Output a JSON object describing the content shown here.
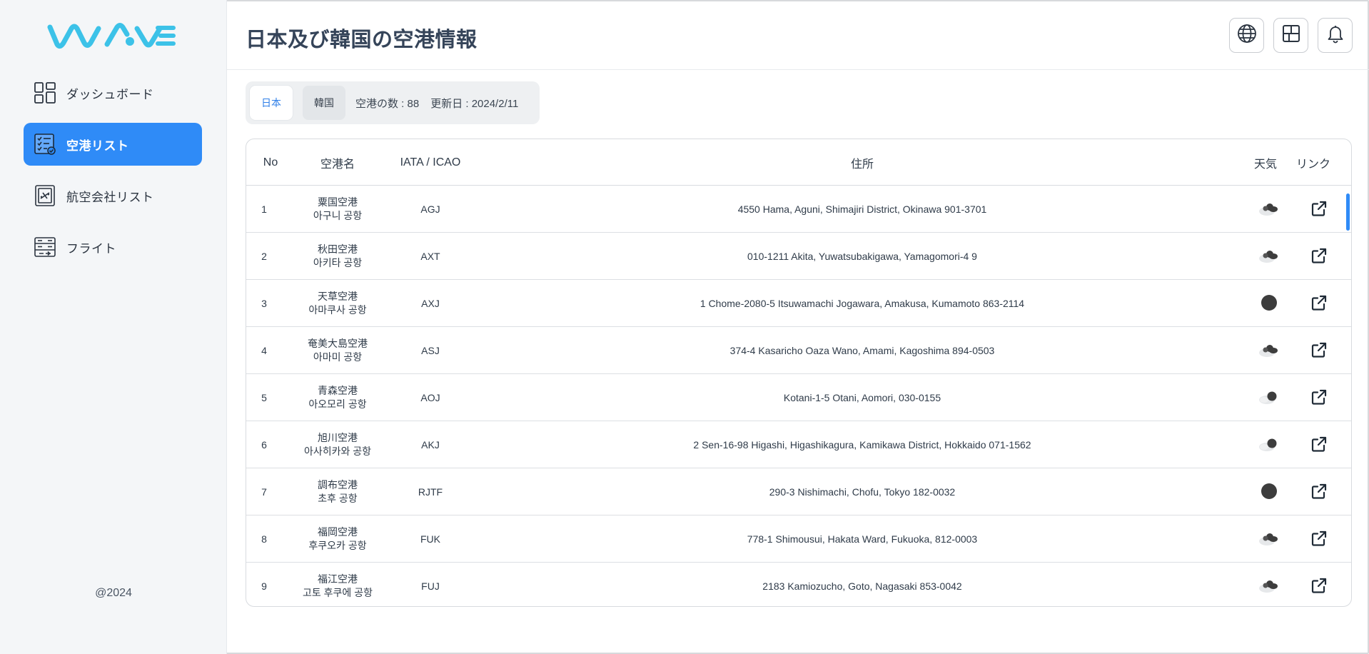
{
  "sidebar": {
    "logo_alt": "WAVE",
    "items": [
      {
        "label": "ダッシュボード",
        "icon": "dashboard-icon"
      },
      {
        "label": "空港リスト",
        "icon": "checklist-icon"
      },
      {
        "label": "航空会社リスト",
        "icon": "airline-card-icon"
      },
      {
        "label": "フライト",
        "icon": "flight-board-icon"
      }
    ],
    "footer": "@2024"
  },
  "header": {
    "title": "日本及び韓国の空港情報",
    "buttons": [
      "globe-icon",
      "layout-icon",
      "bell-icon"
    ]
  },
  "filter": {
    "tabs": [
      "日本",
      "韓国"
    ],
    "count_text": "空港の数 : 88",
    "updated_text": "更新日 : 2024/2/11"
  },
  "table": {
    "headers": {
      "no": "No",
      "name": "空港名",
      "code": "IATA / ICAO",
      "address": "住所",
      "weather": "天気",
      "link": "リンク"
    },
    "rows": [
      {
        "no": "1",
        "name_jp": "粟国空港",
        "name_kr": "아구니 공항",
        "code": "AGJ",
        "address": "4550 Hama, Aguni, Shimajiri District, Okinawa 901-3701",
        "weather": "cloudy"
      },
      {
        "no": "2",
        "name_jp": "秋田空港",
        "name_kr": "아키타 공항",
        "code": "AXT",
        "address": "010-1211 Akita, Yuwatsubakigawa, Yamagomori-4 9",
        "weather": "cloudy"
      },
      {
        "no": "3",
        "name_jp": "天草空港",
        "name_kr": "아마쿠사 공항",
        "code": "AXJ",
        "address": "1 Chome-2080-5 Itsuwamachi Jogawara, Amakusa, Kumamoto 863-2114",
        "weather": "overcast"
      },
      {
        "no": "4",
        "name_jp": "奄美大島空港",
        "name_kr": "아마미 공항",
        "code": "ASJ",
        "address": "374-4 Kasaricho Oaza Wano, Amami, Kagoshima 894-0503",
        "weather": "cloudy"
      },
      {
        "no": "5",
        "name_jp": "青森空港",
        "name_kr": "아오모리 공항",
        "code": "AOJ",
        "address": "Kotani-1-5 Otani, Aomori, 030-0155",
        "weather": "partly-cloudy"
      },
      {
        "no": "6",
        "name_jp": "旭川空港",
        "name_kr": "아사히카와 공항",
        "code": "AKJ",
        "address": "2 Sen-16-98 Higashi, Higashikagura, Kamikawa District, Hokkaido 071-1562",
        "weather": "partly-cloudy"
      },
      {
        "no": "7",
        "name_jp": "調布空港",
        "name_kr": "초후 공항",
        "code": "RJTF",
        "address": "290-3 Nishimachi, Chofu, Tokyo 182-0032",
        "weather": "overcast"
      },
      {
        "no": "8",
        "name_jp": "福岡空港",
        "name_kr": "후쿠오카 공항",
        "code": "FUK",
        "address": "778-1 Shimousui, Hakata Ward, Fukuoka, 812-0003",
        "weather": "cloudy"
      },
      {
        "no": "9",
        "name_jp": "福江空港",
        "name_kr": "고토 후쿠에 공항",
        "code": "FUJ",
        "address": "2183 Kamiozucho, Goto, Nagasaki 853-0042",
        "weather": "cloudy"
      }
    ]
  },
  "colors": {
    "accent": "#2f8bf7",
    "logo": "#3cc2e8",
    "text": "#2b3a4a"
  }
}
